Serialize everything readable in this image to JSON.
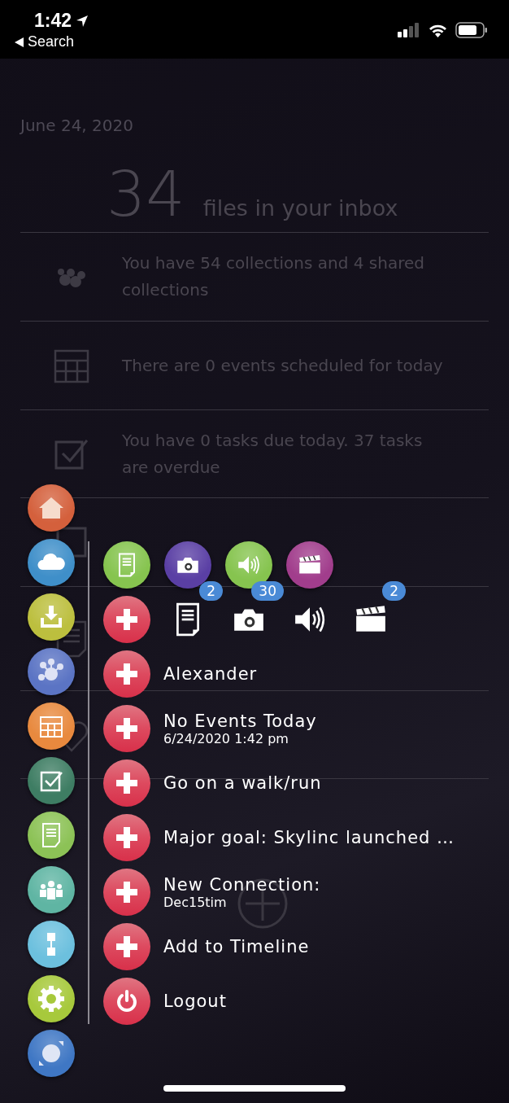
{
  "status_bar": {
    "time": "1:42",
    "back": "Search"
  },
  "dashboard": {
    "date": "June 24, 2020",
    "inbox_count": "34",
    "inbox_label": "files in your inbox",
    "rows": [
      {
        "kind": "collections",
        "text": "You have 54 collections and 4 shared collections"
      },
      {
        "kind": "events",
        "text": "There are 0 events scheduled for today"
      },
      {
        "kind": "tasks",
        "text": "You have 0 tasks due today. 37 tasks are overdue"
      },
      {
        "kind": "connections"
      },
      {
        "kind": "note"
      },
      {
        "kind": "birthday"
      }
    ]
  },
  "menu": {
    "sidebar": [
      {
        "kind": "home",
        "color": "#d4603c"
      },
      {
        "kind": "cloud",
        "color": "#3f8fc9"
      },
      {
        "kind": "inbox",
        "color": "#bcbf3e"
      },
      {
        "kind": "network",
        "color": "#5b74c4"
      },
      {
        "kind": "calendar",
        "color": "#e8893e"
      },
      {
        "kind": "tasks",
        "color": "#3e7d63"
      },
      {
        "kind": "note",
        "color": "#8cc256"
      },
      {
        "kind": "people",
        "color": "#5fb5a3"
      },
      {
        "kind": "connector",
        "color": "#6cc0de"
      },
      {
        "kind": "settings",
        "color": "#a7c93c"
      },
      {
        "kind": "sync",
        "color": "#3f77c4"
      }
    ],
    "categories": [
      {
        "kind": "note",
        "color": "#86c44f"
      },
      {
        "kind": "camera",
        "color": "#5a3fa4"
      },
      {
        "kind": "sound",
        "color": "#86c44f"
      },
      {
        "kind": "video",
        "color": "#a13d8c"
      }
    ],
    "media": [
      {
        "kind": "note",
        "badge": "2"
      },
      {
        "kind": "camera",
        "badge": "30"
      },
      {
        "kind": "sound"
      },
      {
        "kind": "video",
        "badge": "2"
      }
    ],
    "items": [
      {
        "kind": "add",
        "title": "Alexander"
      },
      {
        "kind": "add",
        "title": "No Events Today",
        "subtitle": "6/24/2020 1:42 pm"
      },
      {
        "kind": "add",
        "title": "Go on a walk/run"
      },
      {
        "kind": "add",
        "title": "Major goal: Skylinc launched …"
      },
      {
        "kind": "add",
        "title": "New Connection:",
        "subtitle": "Dec15tim"
      },
      {
        "kind": "add",
        "title": "Add to Timeline"
      },
      {
        "kind": "logout",
        "title": "Logout"
      }
    ]
  }
}
